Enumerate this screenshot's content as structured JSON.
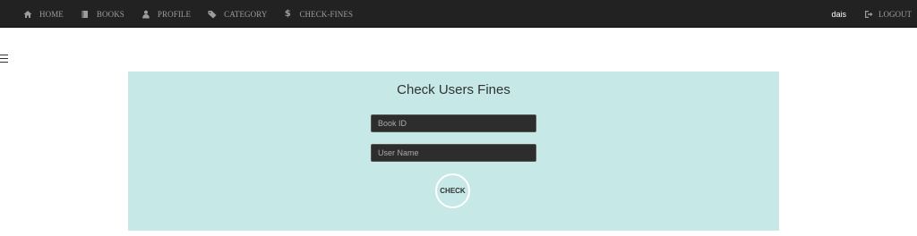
{
  "nav": {
    "items": [
      {
        "label": "HOME",
        "icon": "home-icon"
      },
      {
        "label": "BOOKS",
        "icon": "book-icon"
      },
      {
        "label": "PROFILE",
        "icon": "user-icon"
      },
      {
        "label": "CATEGORY",
        "icon": "tag-icon"
      },
      {
        "label": "CHECK-FINES",
        "icon": "dollar-icon",
        "glyph": "$"
      }
    ],
    "user": "dais",
    "logout_label": "LOGOUT"
  },
  "form": {
    "title": "Check Users Fines",
    "book_id_placeholder": "Book ID",
    "user_name_placeholder": "User Name",
    "check_label": "CHECK"
  },
  "colors": {
    "navbar": "#222222",
    "panel": "#c6e8e6",
    "input": "#2d2d2d"
  }
}
